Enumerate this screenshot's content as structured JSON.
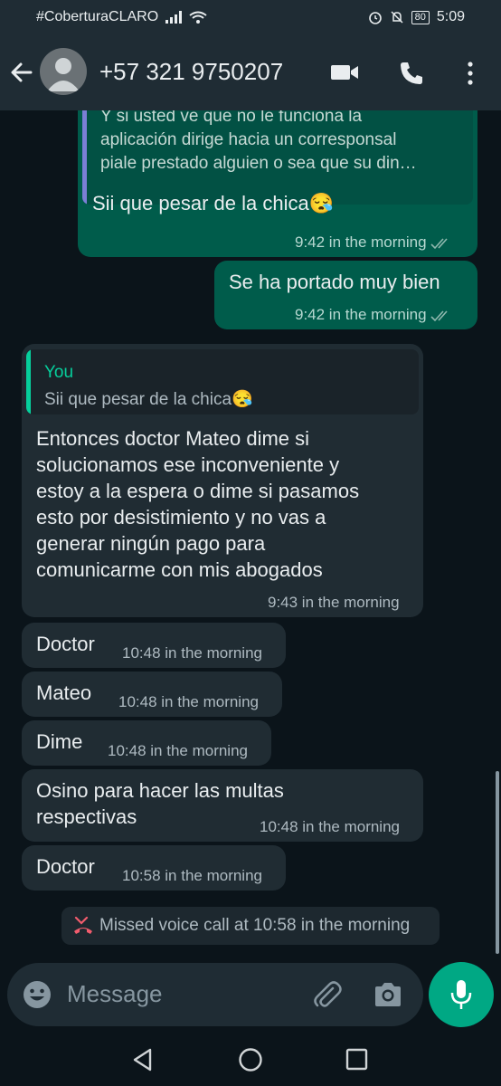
{
  "status_bar": {
    "carrier": "#CoberturaCLARO",
    "battery": "80",
    "time": "5:09"
  },
  "header": {
    "contact": "+57 321 9750207"
  },
  "messages": [
    {
      "quoted_text_lines": [
        "Y si usted ve que no le funciona la",
        "aplicación dirige hacia un corresponsal",
        "piale prestado alguien o sea que su din…"
      ],
      "text": "Sii que pesar de la chica",
      "emoji": "😪",
      "time": "9:42 in the morning"
    },
    {
      "text": "Se ha portado muy bien",
      "time": "9:42 in the morning"
    },
    {
      "quote_author": "You",
      "quote_text": "Sii que pesar de la chica",
      "quote_emoji": "😪",
      "text_lines": [
        "Entonces doctor Mateo dime si",
        "solucionamos ese inconveniente y",
        "estoy a la espera o dime si pasamos",
        "esto por desistimiento y no vas a",
        "generar ningún pago para",
        "comunicarme con mis abogados"
      ],
      "time": "9:43 in the morning"
    },
    {
      "text": "Doctor",
      "time": "10:48 in the morning"
    },
    {
      "text": "Mateo",
      "time": "10:48 in the morning"
    },
    {
      "text": "Dime",
      "time": "10:48 in the morning"
    },
    {
      "text_lines": [
        "Osino para  hacer las multas",
        "respectivas"
      ],
      "time": "10:48 in the morning"
    },
    {
      "text": "Doctor",
      "time": "10:58 in the morning"
    }
  ],
  "missed_call": "Missed voice call at 10:58 in the morning",
  "input": {
    "placeholder": "Message"
  },
  "colors": {
    "background": "#0b141a",
    "outgoing_bubble": "#005c4b",
    "incoming_bubble": "#202c33",
    "accent": "#00a884",
    "read_ticks": "#8fb8ae",
    "missed_call_icon": "#f15c6d"
  },
  "icons": [
    "back-arrow-icon",
    "avatar-icon",
    "video-call-icon",
    "phone-icon",
    "more-vert-icon",
    "emoji-icon",
    "attach-icon",
    "camera-icon",
    "mic-icon",
    "missed-call-icon",
    "back-nav-icon",
    "home-nav-icon",
    "recents-nav-icon"
  ]
}
